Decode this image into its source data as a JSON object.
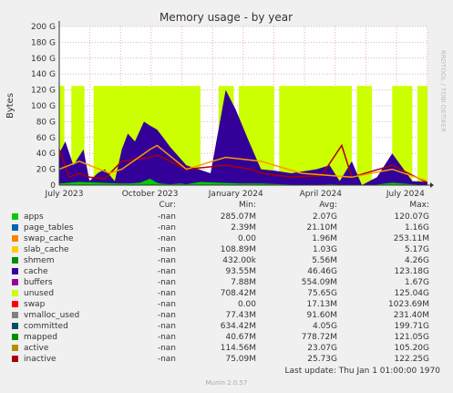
{
  "chart_data": {
    "type": "area",
    "title": "Memory usage - by year",
    "ylabel": "Bytes",
    "ylim": [
      0,
      200
    ],
    "y_unit": "G",
    "y_ticks": [
      "0",
      "20 G",
      "40 G",
      "60 G",
      "80 G",
      "100 G",
      "120 G",
      "140 G",
      "160 G",
      "180 G",
      "200 G"
    ],
    "x_ticks": [
      "July 2023",
      "October 2023",
      "January 2024",
      "April 2024",
      "July 2024"
    ],
    "watermark": "RRDTOOL / TOBI OETIKER",
    "grid": true,
    "series": [
      {
        "name": "apps",
        "color": "#00cc00",
        "x": [
          0,
          20,
          40,
          60,
          70,
          80,
          90,
          97,
          100,
          110,
          120,
          126,
          140,
          158,
          180,
          200,
          220,
          245,
          270,
          290,
          310,
          330,
          350,
          365
        ],
        "values": [
          2,
          4,
          3,
          2,
          2,
          3,
          8,
          3,
          2,
          1,
          2,
          1,
          4,
          3,
          2,
          2,
          1,
          0,
          1,
          0,
          0,
          3,
          1,
          0
        ]
      },
      {
        "name": "cache",
        "color": "#330099",
        "x": [
          0,
          6,
          14,
          24,
          30,
          38,
          45,
          55,
          62,
          68,
          75,
          84,
          90,
          97,
          103,
          110,
          126,
          150,
          165,
          175,
          188,
          200,
          215,
          230,
          245,
          255,
          268,
          278,
          290,
          300,
          315,
          330,
          350,
          365
        ],
        "values": [
          40,
          55,
          25,
          45,
          5,
          15,
          20,
          5,
          45,
          65,
          55,
          80,
          75,
          70,
          60,
          48,
          25,
          15,
          120,
          95,
          55,
          20,
          18,
          15,
          18,
          20,
          25,
          5,
          30,
          0,
          10,
          40,
          5,
          4
        ]
      },
      {
        "name": "unused",
        "color": "#ccff00",
        "segments": [
          [
            0,
            5
          ],
          [
            12,
            25
          ],
          [
            34,
            140
          ],
          [
            158,
            173
          ],
          [
            178,
            213
          ],
          [
            218,
            290
          ],
          [
            295,
            310
          ],
          [
            330,
            350
          ],
          [
            355,
            365
          ]
        ],
        "values": [
          125
        ]
      },
      {
        "name": "inactive",
        "color": "#aa0000",
        "x": [
          0,
          10,
          20,
          30,
          45,
          62,
          90,
          97,
          126,
          165,
          190,
          200,
          230,
          260,
          280,
          290,
          330,
          365
        ],
        "values": [
          45,
          10,
          15,
          10,
          8,
          30,
          35,
          38,
          20,
          25,
          20,
          15,
          10,
          12,
          50,
          10,
          25,
          3
        ]
      },
      {
        "name": "active",
        "color": "#ff9900",
        "x": [
          0,
          20,
          50,
          62,
          90,
          97,
          126,
          165,
          200,
          240,
          290,
          330,
          365
        ],
        "values": [
          20,
          30,
          15,
          20,
          45,
          50,
          20,
          35,
          30,
          15,
          10,
          20,
          5
        ]
      }
    ],
    "legend": {
      "headers": [
        "Cur:",
        "Min:",
        "Avg:",
        "Max:"
      ],
      "rows": [
        {
          "name": "apps",
          "color": "#00cc00",
          "cur": "-nan",
          "min": "285.07M",
          "avg": "2.07G",
          "max": "120.07G"
        },
        {
          "name": "page_tables",
          "color": "#0066b3",
          "cur": "-nan",
          "min": "2.39M",
          "avg": "21.10M",
          "max": "1.16G"
        },
        {
          "name": "swap_cache",
          "color": "#ff8000",
          "cur": "-nan",
          "min": "0.00",
          "avg": "1.96M",
          "max": "253.11M"
        },
        {
          "name": "slab_cache",
          "color": "#ffcc00",
          "cur": "-nan",
          "min": "108.89M",
          "avg": "1.03G",
          "max": "5.17G"
        },
        {
          "name": "shmem",
          "color": "#008f00",
          "cur": "-nan",
          "min": "432.00k",
          "avg": "5.56M",
          "max": "4.26G"
        },
        {
          "name": "cache",
          "color": "#330099",
          "cur": "-nan",
          "min": "93.55M",
          "avg": "46.46G",
          "max": "123.18G"
        },
        {
          "name": "buffers",
          "color": "#990099",
          "cur": "-nan",
          "min": "7.88M",
          "avg": "554.09M",
          "max": "1.67G"
        },
        {
          "name": "unused",
          "color": "#ccff00",
          "cur": "-nan",
          "min": "708.42M",
          "avg": "75.65G",
          "max": "125.04G"
        },
        {
          "name": "swap",
          "color": "#ff0000",
          "cur": "-nan",
          "min": "0.00",
          "avg": "17.13M",
          "max": "1023.69M"
        },
        {
          "name": "vmalloc_used",
          "color": "#808080",
          "cur": "-nan",
          "min": "77.43M",
          "avg": "91.60M",
          "max": "231.40M"
        },
        {
          "name": "committed",
          "color": "#004d66",
          "cur": "-nan",
          "min": "634.42M",
          "avg": "4.05G",
          "max": "199.71G"
        },
        {
          "name": "mapped",
          "color": "#008f00",
          "cur": "-nan",
          "min": "40.67M",
          "avg": "778.72M",
          "max": "121.05G"
        },
        {
          "name": "active",
          "color": "#b38f00",
          "cur": "-nan",
          "min": "114.56M",
          "avg": "23.07G",
          "max": "105.20G"
        },
        {
          "name": "inactive",
          "color": "#aa0000",
          "cur": "-nan",
          "min": "75.09M",
          "avg": "25.73G",
          "max": "122.25G"
        }
      ]
    }
  },
  "footer": {
    "last_update": "Last update: Thu Jan  1 01:00:00 1970",
    "munin": "Munin 2.0.57"
  }
}
